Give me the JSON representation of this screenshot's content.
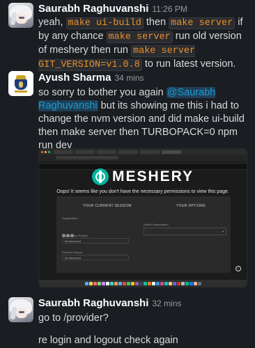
{
  "messages": [
    {
      "author": "Saurabh Raghuvanshi",
      "time": "11:26 PM",
      "parts": {
        "t1": "yeah, ",
        "c1": "make ui-build",
        "t2": " then ",
        "c2": "make server",
        "t3": " if by any chance ",
        "c3": "make server",
        "t4": " run old version of  meshery then run ",
        "c4": "make server GIT_VERSION=v1.0.8",
        "t5": " to run latest version."
      }
    },
    {
      "author": "Ayush Sharma",
      "time": "34 mins",
      "text_before": "so sorry to bother you again ",
      "mention": "@Saurabh Raghuvanshi",
      "text_after": " but its showing me this i had to change the nvm version and did make ui-build then make server then TURBOPACK=0 npm run dev"
    },
    {
      "author": "Saurabh Raghuvanshi",
      "time": "32 mins",
      "line1": "go to /provider?",
      "line2": "re login and logout check again"
    }
  ],
  "screenshot": {
    "logo_text": "MESHERY",
    "oops": "Oops! It seems like you don't have the necessary permissions to view this page.",
    "current_session": "YOUR CURRENT SESSION",
    "your_options": "YOUR OPTIONS",
    "organization_label": "Organization",
    "org_roles_label": "Organization Role(s)",
    "no_roles_1": "No roles found",
    "provider_roles_label": "Provider Role(s)",
    "no_roles_2": "No roles found",
    "switch_org_label": "Switch Organization",
    "info_glyph": "i",
    "accent": "#00b39f"
  },
  "colors": {
    "background": "#1a1d21",
    "code_text": "#e8912d",
    "mention": "#1d9bd1"
  }
}
